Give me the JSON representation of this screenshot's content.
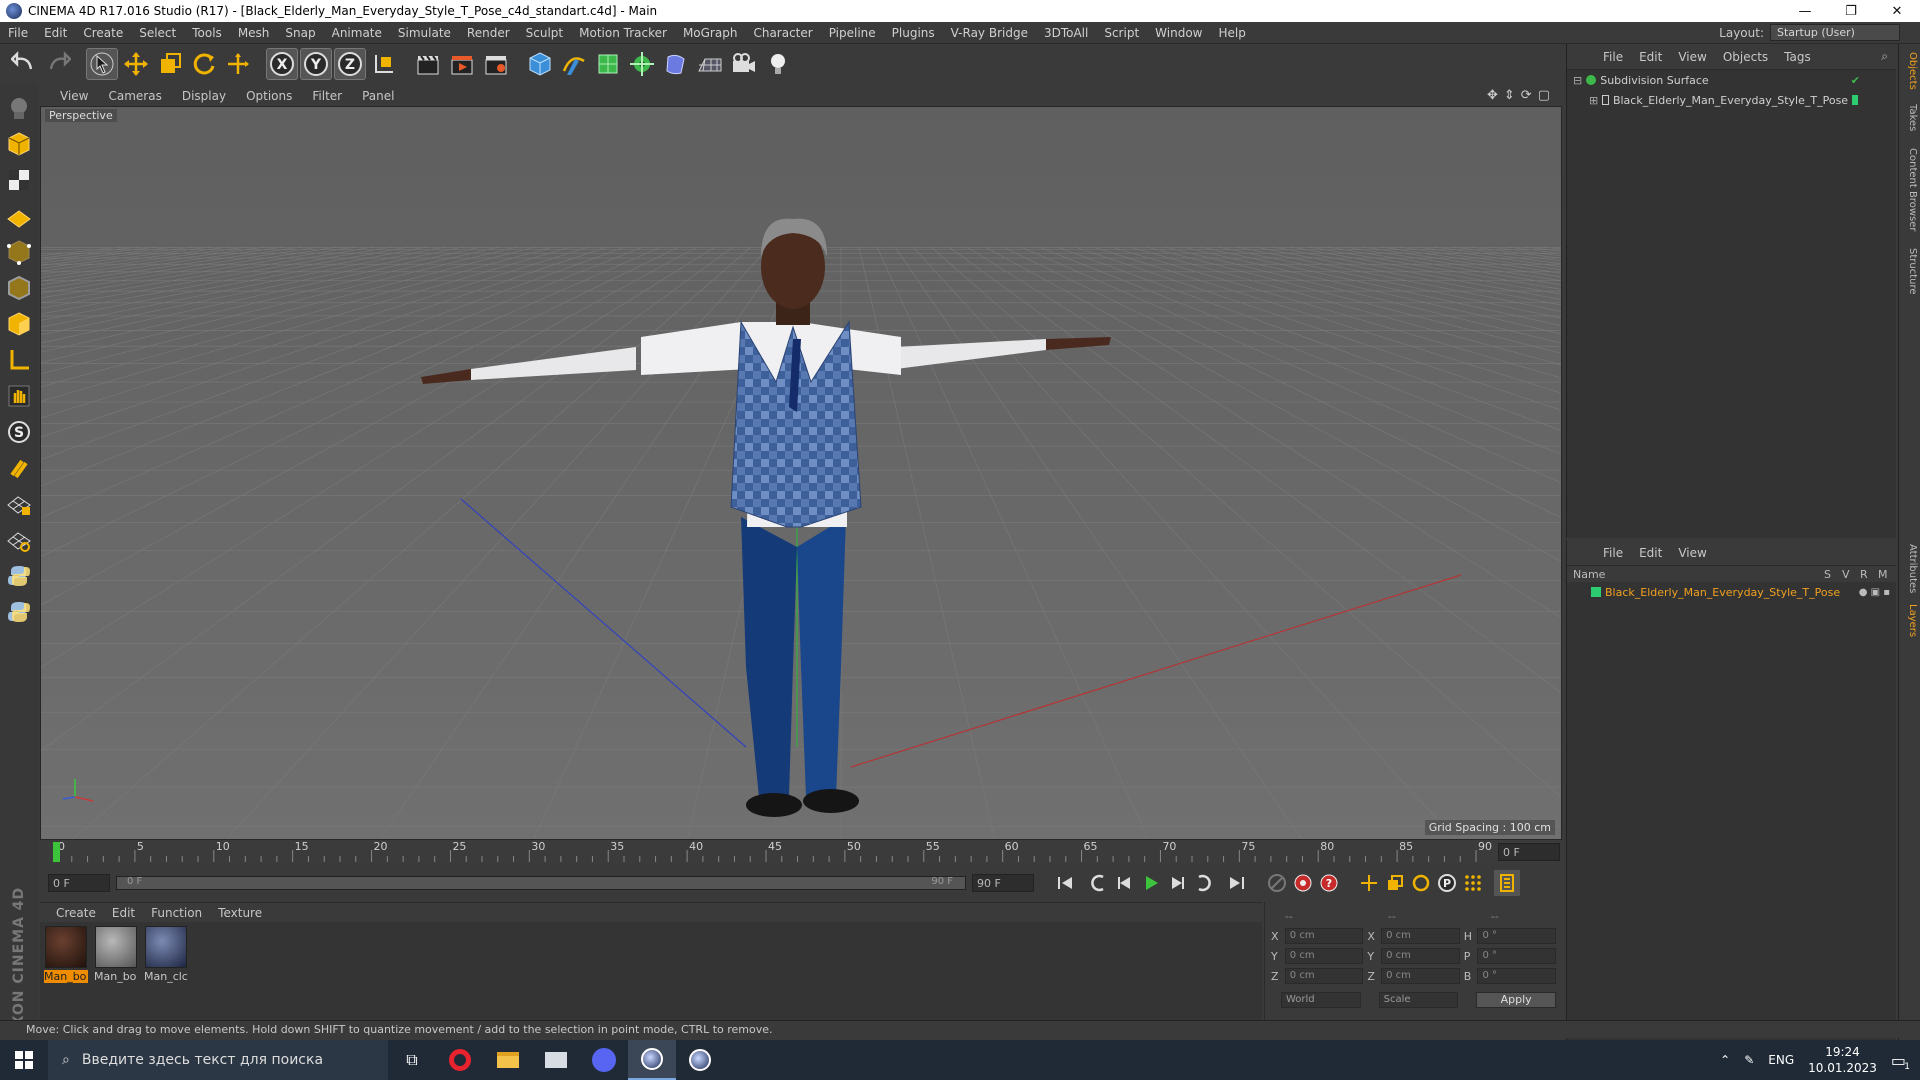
{
  "window": {
    "title": "CINEMA 4D R17.016 Studio (R17) - [Black_Elderly_Man_Everyday_Style_T_Pose_c4d_standart.c4d] - Main",
    "minimize": "—",
    "maximize": "❐",
    "close": "✕"
  },
  "menu": [
    "File",
    "Edit",
    "Create",
    "Select",
    "Tools",
    "Mesh",
    "Snap",
    "Animate",
    "Simulate",
    "Render",
    "Sculpt",
    "Motion Tracker",
    "MoGraph",
    "Character",
    "Pipeline",
    "Plugins",
    "V-Ray Bridge",
    "3DToAll",
    "Script",
    "Window",
    "Help"
  ],
  "layout": {
    "label": "Layout:",
    "value": "Startup (User)"
  },
  "viewport": {
    "menu": [
      "View",
      "Cameras",
      "Display",
      "Options",
      "Filter",
      "Panel"
    ],
    "label": "Perspective",
    "grid_spacing": "Grid Spacing : 100 cm"
  },
  "timeline": {
    "ticks": [
      "0",
      "5",
      "10",
      "15",
      "20",
      "25",
      "30",
      "35",
      "40",
      "45",
      "50",
      "55",
      "60",
      "65",
      "70",
      "75",
      "80",
      "85",
      "90"
    ],
    "current_frame": "0 F",
    "start_field": "0 F",
    "range_start": "0 F",
    "range_end": "90 F",
    "end_field": "90 F"
  },
  "materials": {
    "menu": [
      "Create",
      "Edit",
      "Function",
      "Texture"
    ],
    "items": [
      {
        "name": "Man_bo",
        "selected": true
      },
      {
        "name": "Man_bo",
        "selected": false
      },
      {
        "name": "Man_clc",
        "selected": false
      }
    ]
  },
  "coords": {
    "header": [
      "--",
      "--",
      "--"
    ],
    "rows": [
      {
        "a": "X",
        "av": "0 cm",
        "b": "X",
        "bv": "0 cm",
        "c": "H",
        "cv": "0 °"
      },
      {
        "a": "Y",
        "av": "0 cm",
        "b": "Y",
        "bv": "0 cm",
        "c": "P",
        "cv": "0 °"
      },
      {
        "a": "Z",
        "av": "0 cm",
        "b": "Z",
        "bv": "0 cm",
        "c": "B",
        "cv": "0 °"
      }
    ],
    "world": "World",
    "scale": "Scale",
    "apply": "Apply"
  },
  "object_manager": {
    "menu": [
      "File",
      "Edit",
      "View",
      "Objects",
      "Tags"
    ],
    "objects": [
      {
        "name": "Subdivision Surface"
      },
      {
        "name": "Black_Elderly_Man_Everyday_Style_T_Pose"
      }
    ]
  },
  "layer_manager": {
    "menu": [
      "File",
      "Edit",
      "View"
    ],
    "columns": {
      "name": "Name",
      "s": "S",
      "v": "V",
      "r": "R",
      "m": "M"
    },
    "layers": [
      {
        "name": "Black_Elderly_Man_Everyday_Style_T_Pose"
      }
    ]
  },
  "side_tabs": [
    "Objects",
    "Takes",
    "Content Browser",
    "Structure",
    "Attributes",
    "Layers"
  ],
  "status": "Move: Click and drag to move elements. Hold down SHIFT to quantize movement / add to the selection in point mode, CTRL to remove.",
  "taskbar": {
    "search_placeholder": "Введите здесь текст для поиска",
    "lang": "ENG",
    "time": "19:24",
    "date": "10.01.2023",
    "notifications": "1"
  },
  "colors": {
    "accent": "#f08c00",
    "layer_green": "#2ecc71",
    "axis_x": "#c83a3a",
    "axis_y": "#3ac83a",
    "axis_z": "#3a5ad8"
  }
}
